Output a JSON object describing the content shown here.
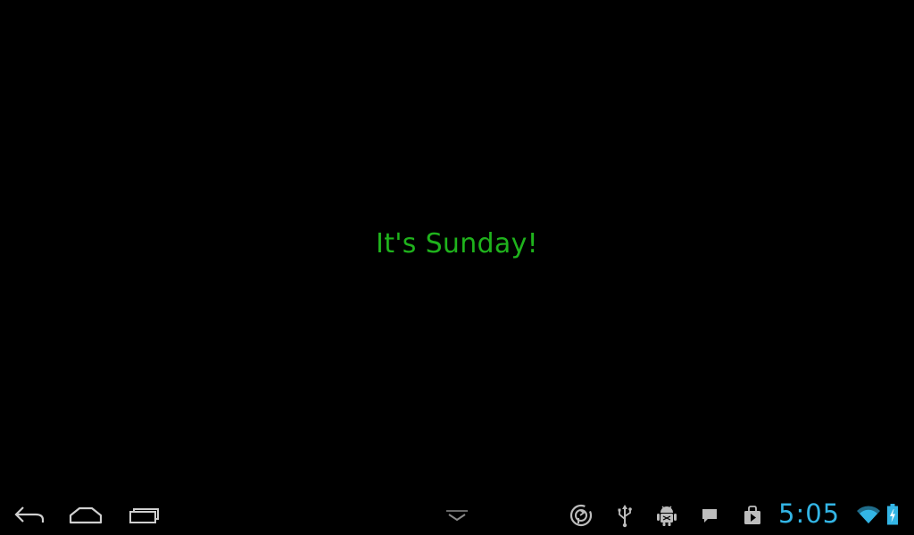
{
  "app": {
    "message": "It's Sunday!",
    "message_color": "#1fb21c",
    "background": "#000000"
  },
  "system_bar": {
    "nav_buttons": [
      {
        "name": "back",
        "icon": "back-arrow-icon"
      },
      {
        "name": "home",
        "icon": "home-icon"
      },
      {
        "name": "recent-apps",
        "icon": "recent-apps-icon"
      }
    ],
    "ime_switch_icon": "chevron-down-icon",
    "notification_icons": [
      "sync-icon",
      "usb-icon",
      "android-debug-icon",
      "chat-icon",
      "play-store-icon"
    ],
    "clock": "5:05",
    "clock_color": "#33b5e5",
    "status_icons": [
      "wifi-icon",
      "battery-charging-icon"
    ]
  }
}
